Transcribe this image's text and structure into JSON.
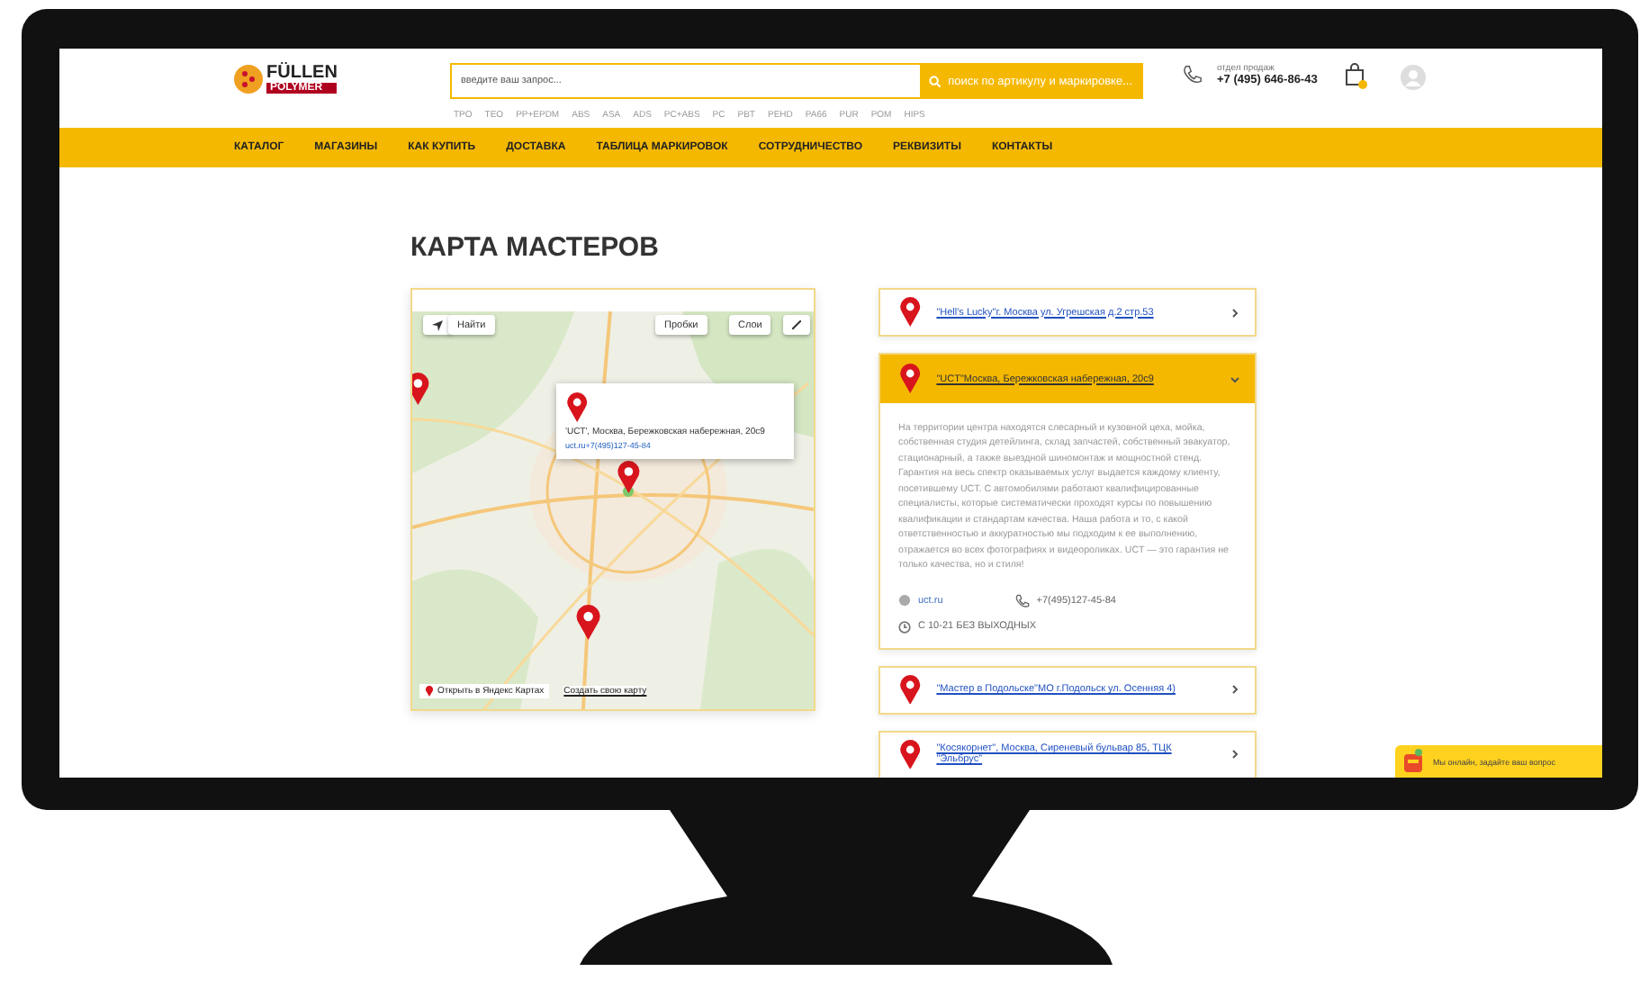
{
  "header": {
    "logo": {
      "top": "FÜLLEN",
      "bottom": "POLYMER"
    },
    "search": {
      "placeholder": "введите ваш запрос...",
      "button": "поиск по артикулу и маркировке..."
    },
    "tags": [
      "TPO",
      "TEO",
      "PP+EPDM",
      "ABS",
      "ASA",
      "ADS",
      "PC+ABS",
      "PC",
      "PBT",
      "PEHD",
      "PA66",
      "PUR",
      "POM",
      "HIPS"
    ],
    "contact": {
      "label": "отдел продаж",
      "phone": "+7 (495) 646-86-43"
    }
  },
  "nav": [
    {
      "label": "КАТАЛОГ"
    },
    {
      "label": "МАГАЗИНЫ"
    },
    {
      "label": "КАК КУПИТЬ"
    },
    {
      "label": "ДОСТАВКА"
    },
    {
      "label": "ТАБЛИЦА МАРКИРОВОК"
    },
    {
      "label": "СОТРУДНИЧЕСТВО"
    },
    {
      "label": "РЕКВИЗИТЫ"
    },
    {
      "label": "КОНТАКТЫ"
    }
  ],
  "heading": "КАРТА МАСТЕРОВ",
  "map": {
    "search": "Найти",
    "traffic": "Пробки",
    "layers": "Слои",
    "popup": {
      "title": "'UCT', Москва, Бережковская набережная, 20с9",
      "link": "uct.ru+7(495)127-45-84"
    },
    "open_link": "Открыть в Яндекс Картах",
    "create_link": "Создать свою карту"
  },
  "masters": [
    {
      "title": "\"Hell's Lucky\"г. Москва ул. Угрешская д.2 стр.53",
      "expanded": false
    },
    {
      "title": "\"UCT\"Москва, Бережковская набережная, 20с9",
      "expanded": true,
      "description": "На территории центра находятся слесарный и кузовной цеха, мойка, собственная студия детейлинга, склад запчастей, собственный эвакуатор, стационарный, а также выездной шиномонтаж и мощностной стенд. Гарантия на весь спектр оказываемых услуг выдается каждому клиенту, посетившему UCT. С автомобилями работают квалифицированные специалисты, которые систематически проходят курсы по повышению квалификации и стандартам качества. Наша работа и то, с какой ответственностью и аккуратностью мы подходим к ее выполнению, отражается во всех фотографиях и видеороликах. UCT — это гарантия не только качества, но и стиля!",
      "site": "uct.ru",
      "phone": "+7(495)127-45-84",
      "hours": "С 10-21 БЕЗ ВЫХОДНЫХ"
    },
    {
      "title": "\"Мастер в Подольске\"МО г.Подольск ул. Осенняя 4)",
      "expanded": false
    },
    {
      "title": "\"Косякорнет\", Москва, Сиреневый бульвар 85, ТЦК \"Эльбрус\"",
      "expanded": false
    }
  ],
  "chat": {
    "text": "Мы онлайн, задайте ваш вопрос"
  }
}
